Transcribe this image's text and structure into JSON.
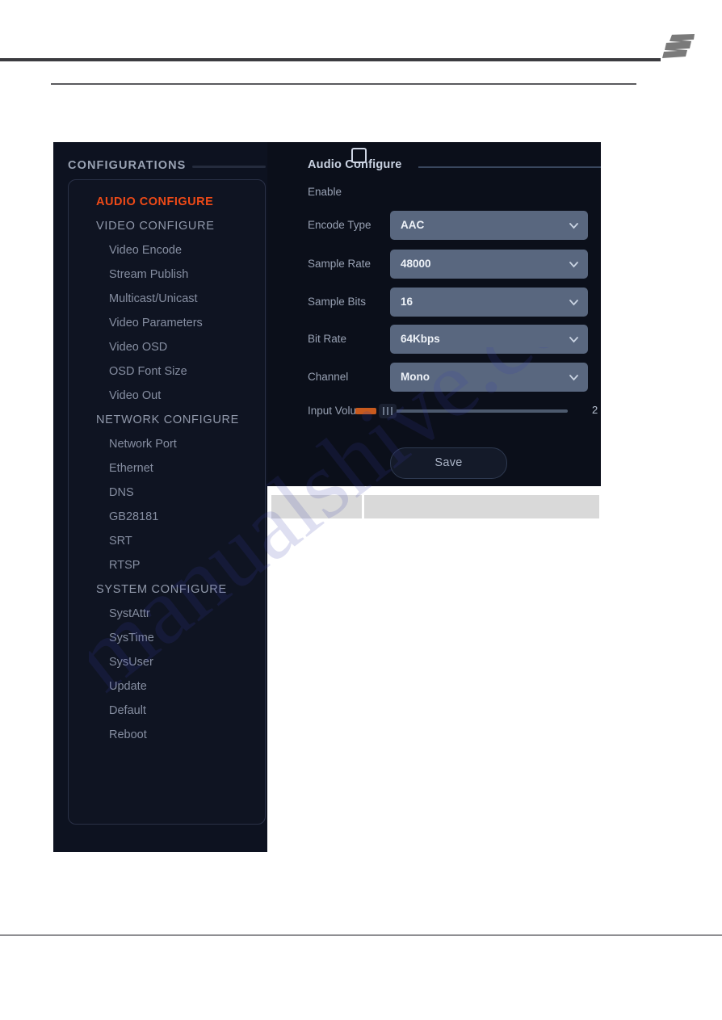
{
  "page": {
    "brand_logo_icon": "brand-logo-icon",
    "watermark_text": "manualshive.com"
  },
  "sidebar": {
    "header": "CONFIGURATIONS",
    "items": [
      {
        "label": "AUDIO CONFIGURE",
        "level": "group",
        "active": true
      },
      {
        "label": "VIDEO CONFIGURE",
        "level": "group",
        "active": false
      },
      {
        "label": "Video Encode",
        "level": "child",
        "active": false
      },
      {
        "label": "Stream Publish",
        "level": "child",
        "active": false
      },
      {
        "label": "Multicast/Unicast",
        "level": "child",
        "active": false
      },
      {
        "label": "Video Parameters",
        "level": "child",
        "active": false
      },
      {
        "label": "Video OSD",
        "level": "child",
        "active": false
      },
      {
        "label": "OSD Font Size",
        "level": "child",
        "active": false
      },
      {
        "label": "Video Out",
        "level": "child",
        "active": false
      },
      {
        "label": "NETWORK CONFIGURE",
        "level": "group",
        "active": false
      },
      {
        "label": "Network Port",
        "level": "child",
        "active": false
      },
      {
        "label": "Ethernet",
        "level": "child",
        "active": false
      },
      {
        "label": "DNS",
        "level": "child",
        "active": false
      },
      {
        "label": "GB28181",
        "level": "child",
        "active": false
      },
      {
        "label": "SRT",
        "level": "child",
        "active": false
      },
      {
        "label": "RTSP",
        "level": "child",
        "active": false
      },
      {
        "label": "SYSTEM CONFIGURE",
        "level": "group",
        "active": false
      },
      {
        "label": "SystAttr",
        "level": "child",
        "active": false
      },
      {
        "label": "SysTime",
        "level": "child",
        "active": false
      },
      {
        "label": "SysUser",
        "level": "child",
        "active": false
      },
      {
        "label": "Update",
        "level": "child",
        "active": false
      },
      {
        "label": "Default",
        "level": "child",
        "active": false
      },
      {
        "label": "Reboot",
        "level": "child",
        "active": false
      }
    ]
  },
  "content": {
    "title": "Audio Configure",
    "fields": {
      "enable": {
        "label": "Enable",
        "checked": false
      },
      "encode_type": {
        "label": "Encode Type",
        "value": "AAC"
      },
      "sample_rate": {
        "label": "Sample Rate",
        "value": "48000"
      },
      "sample_bits": {
        "label": "Sample Bits",
        "value": "16"
      },
      "bit_rate": {
        "label": "Bit Rate",
        "value": "64Kbps"
      },
      "channel": {
        "label": "Channel",
        "value": "Mono"
      },
      "input_volume": {
        "label": "Input Volume",
        "value": "2"
      }
    },
    "save_label": "Save"
  },
  "colors": {
    "accent_orange": "#ef4a17",
    "select_background": "#59677f",
    "panel_background": "#0b0f1a",
    "sidebar_background": "#0d1220",
    "slider_fill": "#c85a1e"
  }
}
